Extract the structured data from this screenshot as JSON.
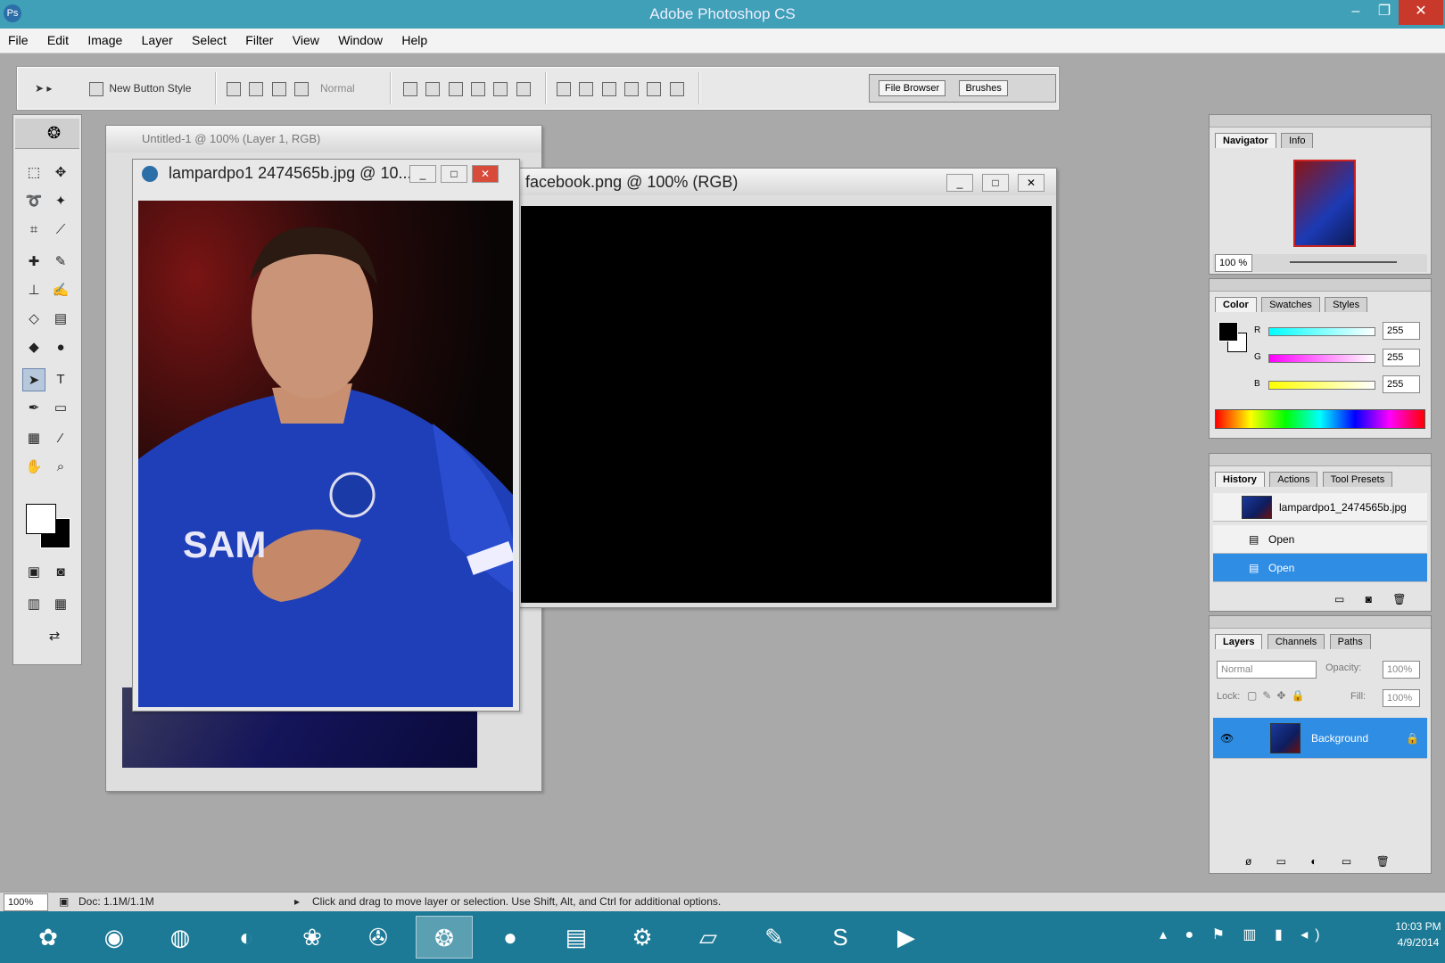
{
  "window": {
    "title": "Adobe Photoshop CS",
    "minimize": "–",
    "maximize": "❐",
    "close": "✕"
  },
  "menu": [
    "File",
    "Edit",
    "Image",
    "Layer",
    "Select",
    "Filter",
    "View",
    "Window",
    "Help"
  ],
  "options_bar": {
    "tool_preset": "▸",
    "new_button": "New Button Style",
    "blend": "Normal",
    "palette_tabs": [
      "File Browser",
      "Brushes"
    ]
  },
  "documents": {
    "back": {
      "title": "Untitled-1 @ 100% (Layer 1, RGB)"
    },
    "facebook": {
      "title": "facebook.png @ 100% (RGB)"
    },
    "photo": {
      "title": "lampardpo1 2474565b.jpg @ 10...",
      "shirt_text": "SAM"
    }
  },
  "navigator": {
    "tabs": [
      "Navigator",
      "Info"
    ],
    "zoom": "100 %"
  },
  "color": {
    "tabs": [
      "Color",
      "Swatches",
      "Styles"
    ],
    "channels": [
      {
        "label": "R",
        "value": "255",
        "gradient": "linear-gradient(to right,#00ffff,#ffffff)"
      },
      {
        "label": "G",
        "value": "255",
        "gradient": "linear-gradient(to right,#ff00ff,#ffffff)"
      },
      {
        "label": "B",
        "value": "255",
        "gradient": "linear-gradient(to right,#ffff00,#ffffff)"
      }
    ]
  },
  "history": {
    "tabs": [
      "History",
      "Actions",
      "Tool Presets"
    ],
    "items": [
      "lampardpo1_2474565b.jpg",
      "Open",
      "Open"
    ]
  },
  "layers": {
    "tabs": [
      "Layers",
      "Channels",
      "Paths"
    ],
    "mode": "Normal",
    "opacity_label": "Opacity:",
    "opacity": "100%",
    "lock_label": "Lock:",
    "fill_label": "Fill:",
    "fill": "100%",
    "layer_name": "Background"
  },
  "status": {
    "zoom": "100%",
    "doc": "Doc: 1.1M/1.1M",
    "hint": "Click and drag to move layer or selection. Use Shift, Alt, and Ctrl for additional options."
  },
  "taskbar": {
    "icons": [
      "app-icon",
      "chrome-icon",
      "firefox-icon",
      "media-icon",
      "picasa-icon",
      "cleaner-icon",
      "photoshop-icon",
      "green-app-icon",
      "explorer-icon",
      "tools-icon",
      "notepad-icon",
      "paint-icon",
      "skype-icon",
      "video-icon"
    ],
    "time": "10:03 PM",
    "date": "4/9/2014"
  },
  "colors": {
    "titlebar": "#3fa0b8",
    "taskbar": "#1d7a96",
    "selection": "#2f8de4",
    "close": "#c8392b"
  }
}
